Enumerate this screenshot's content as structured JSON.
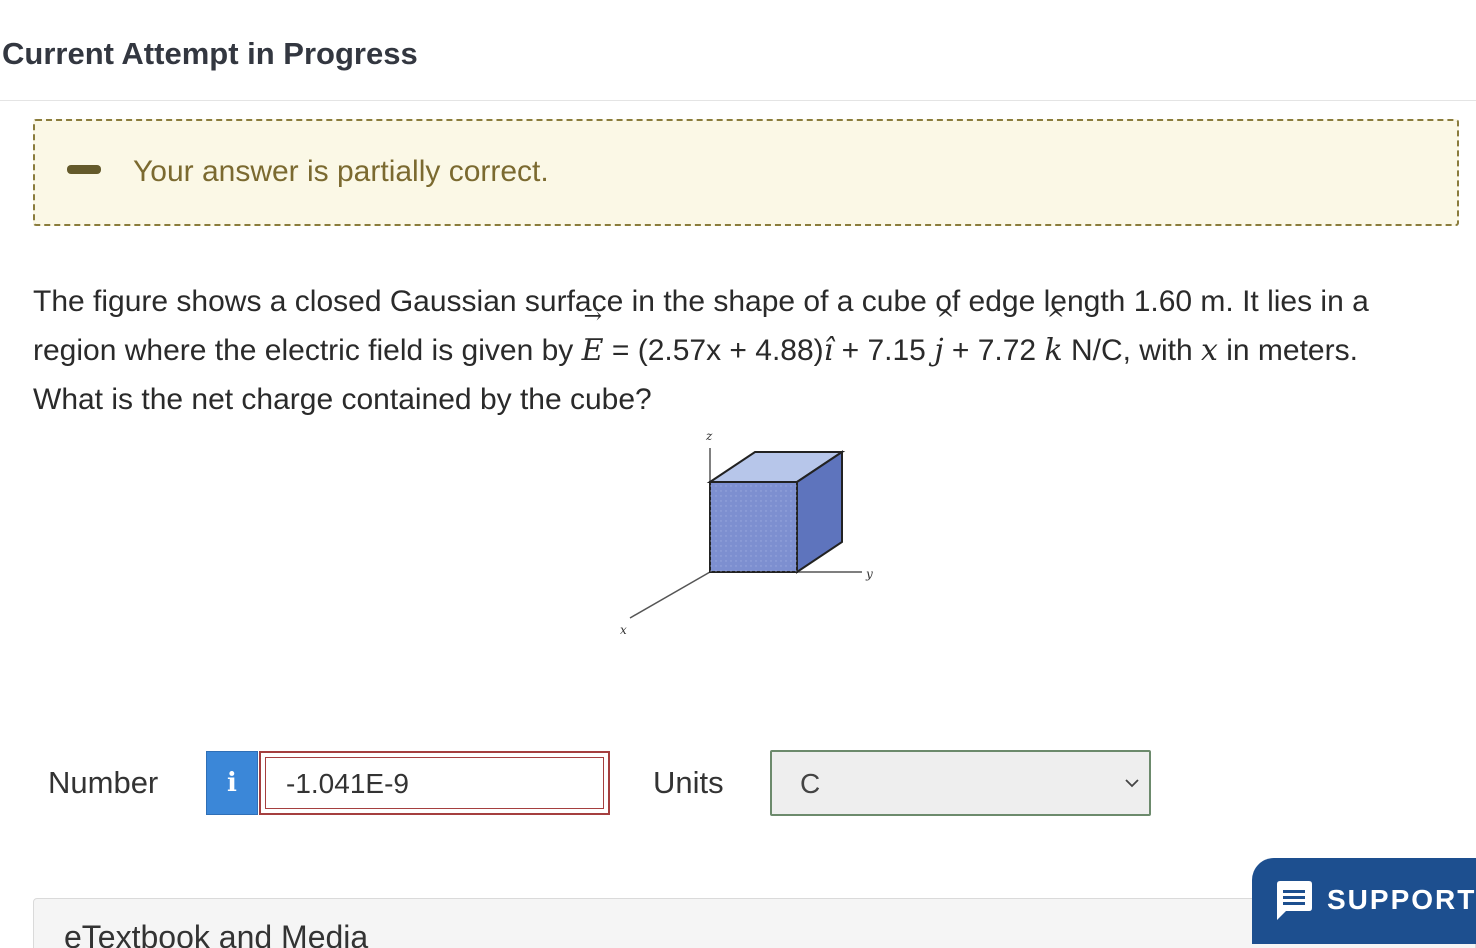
{
  "header": {
    "title": "Current Attempt in Progress"
  },
  "feedback": {
    "message": "Your answer is partially correct."
  },
  "question": {
    "line1": "The figure shows a closed Gaussian surface in the shape of a cube of edge length 1.60 m. It lies in a",
    "line2_prefix": "region where the electric field is given by ",
    "e_symbol": "E",
    "arrow": "→",
    "line2_expr": " = (2.57x + 4.88)",
    "i_hat": "î",
    "plus_j": " + 7.15 ",
    "j_symbol": "j",
    "plus_k": " + 7.72 ",
    "k_symbol": "k",
    "caret": "^",
    "line2_suffix_a": " N/C, with ",
    "x_var": "x",
    "line2_suffix_b": " in meters.",
    "line3": "What is the net charge contained by the cube?"
  },
  "figure": {
    "z_label": "z",
    "y_label": "y",
    "x_label": "x",
    "cube_colors": {
      "front": "#7d8fd0",
      "top": "#b7c6ea",
      "side": "#5e74bd"
    }
  },
  "answer": {
    "number_label": "Number",
    "info_icon": "i",
    "value": "-1.041E-9",
    "units_label": "Units",
    "units_value": "C"
  },
  "etextbook": {
    "label": "eTextbook and Media"
  },
  "support": {
    "label": "SUPPORT"
  },
  "colors": {
    "feedback_bg": "#fbf8e6",
    "feedback_text": "#7b6a30",
    "info_blue": "#3b87d8",
    "error_border": "#a53f3f",
    "support_bg": "#1d4f8f"
  }
}
